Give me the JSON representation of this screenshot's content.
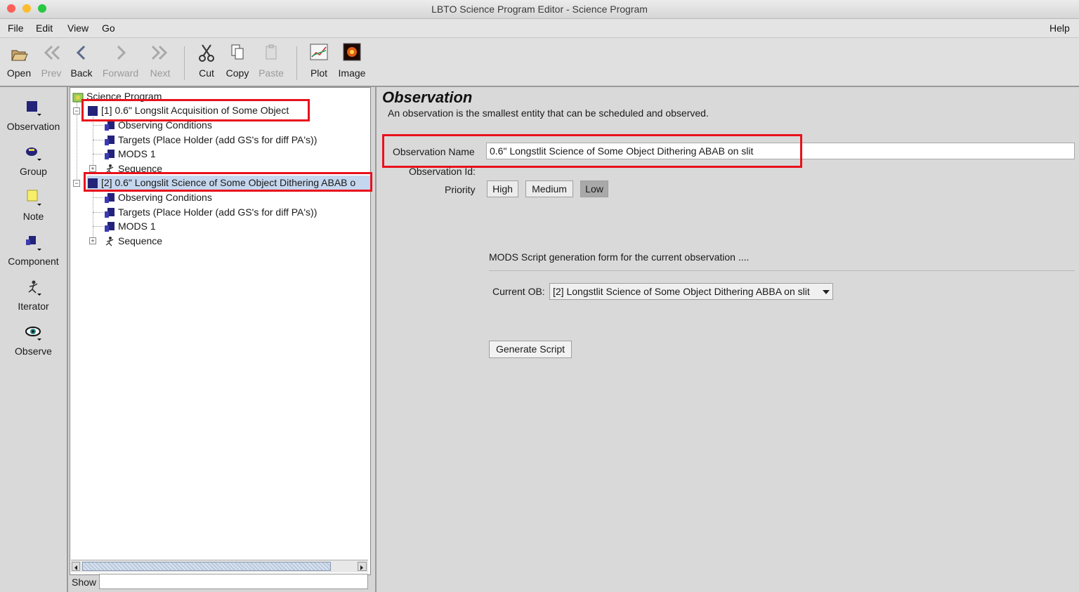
{
  "window": {
    "title": "LBTO Science Program Editor - Science Program"
  },
  "menubar": {
    "items": [
      "File",
      "Edit",
      "View",
      "Go"
    ],
    "help": "Help"
  },
  "toolbar": {
    "open": "Open",
    "prev": "Prev",
    "back": "Back",
    "forward": "Forward",
    "next": "Next",
    "cut": "Cut",
    "copy": "Copy",
    "paste": "Paste",
    "plot": "Plot",
    "image": "Image"
  },
  "palette": {
    "items": [
      "Observation",
      "Group",
      "Note",
      "Component",
      "Iterator",
      "Observe"
    ]
  },
  "tree": {
    "root": "Science Program",
    "obs1": {
      "label": "[1] 0.6\" Longslit Acquisition of Some Object",
      "children": [
        "Observing Conditions",
        "Targets (Place Holder (add GS's for diff PA's))",
        "MODS 1",
        "Sequence"
      ]
    },
    "obs2": {
      "label": "[2] 0.6\" Longslit Science of Some Object Dithering ABAB o",
      "children": [
        "Observing Conditions",
        "Targets (Place Holder (add GS's for diff PA's))",
        "MODS 1",
        "Sequence"
      ]
    },
    "show_label": "Show",
    "show_value": ""
  },
  "editor": {
    "heading": "Observation",
    "description": "An observation is the smallest entity that can be scheduled and observed.",
    "name_label": "Observation Name",
    "name_value": "0.6\" Longstlit Science of Some Object Dithering ABAB on slit",
    "id_label": "Observation Id:",
    "priority_label": "Priority",
    "priority_options": [
      "High",
      "Medium",
      "Low"
    ],
    "priority_selected": "Low",
    "mods_text": "MODS Script generation form for the current observation ....",
    "current_ob_label": "Current OB:",
    "current_ob_value": "[2] Longstlit Science of Some Object Dithering ABBA on slit",
    "generate_button": "Generate Script"
  },
  "colors": {
    "highlight_box": "#e8121b",
    "selection": "#c5d7ee",
    "obs_icon": "#23237a"
  }
}
